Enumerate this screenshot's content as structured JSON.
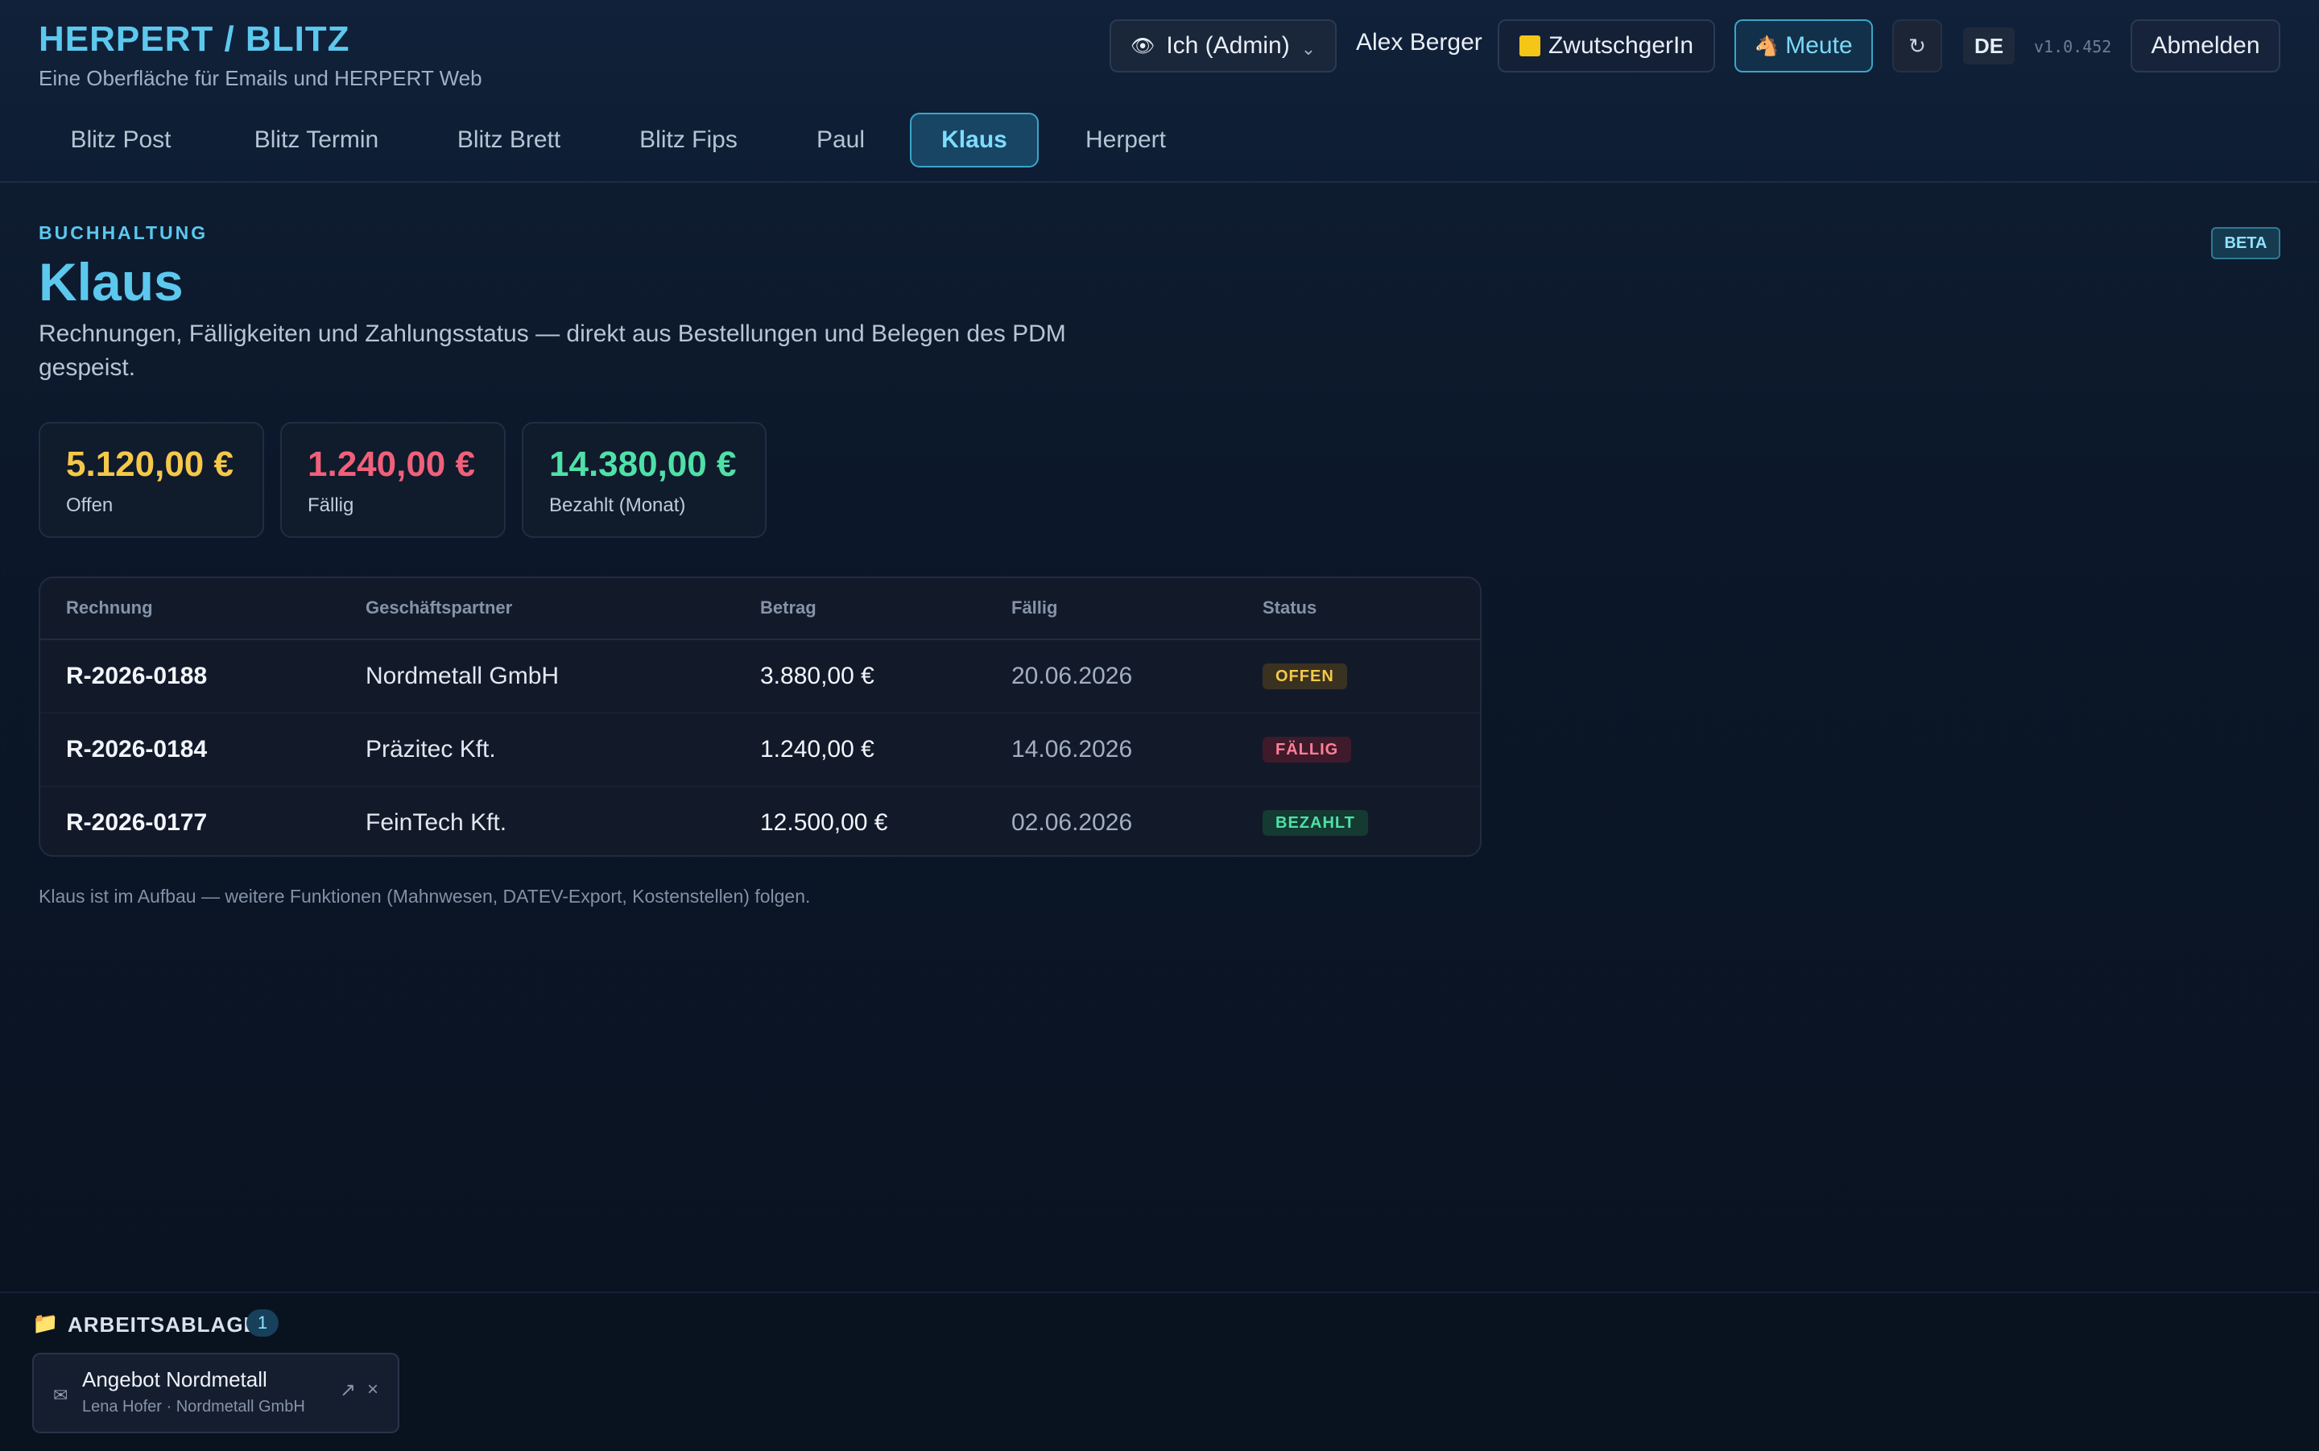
{
  "header": {
    "title": "HERPERT / BLITZ",
    "subtitle": "Eine Oberfläche für Emails und HERPERT Web",
    "role_selector": {
      "icon": "eye-icon",
      "label": "Ich (Admin)",
      "chevron": "⌄"
    },
    "user_name": "Alex Berger",
    "zwb_button": {
      "icon": "yellow-square-icon",
      "label": "ZwutschgerIn"
    },
    "meute_button": {
      "icon": "horse-head-icon",
      "label": "Meute",
      "glyph": "🐴"
    },
    "refresh_glyph": "↻",
    "language": "DE",
    "version": "v1.0.452",
    "logout_label": "Abmelden"
  },
  "tabs": [
    {
      "label": "Blitz Post",
      "active": false
    },
    {
      "label": "Blitz Termin",
      "active": false
    },
    {
      "label": "Blitz Brett",
      "active": false
    },
    {
      "label": "Blitz Fips",
      "active": false
    },
    {
      "label": "Paul",
      "active": false
    },
    {
      "label": "Klaus",
      "active": true
    },
    {
      "label": "Herpert",
      "active": false
    }
  ],
  "main": {
    "section_label": "BUCHHALTUNG",
    "title": "Klaus",
    "description": "Rechnungen, Fälligkeiten und Zahlungsstatus — direkt aus Bestellungen und Belegen des PDM gespeist.",
    "badge": "BETA",
    "stats": [
      {
        "value": "5.120,00 €",
        "label": "Offen",
        "color": "#f5c84a"
      },
      {
        "value": "1.240,00 €",
        "label": "Fällig",
        "color": "#f0607a"
      },
      {
        "value": "14.380,00 €",
        "label": "Bezahlt (Monat)",
        "color": "#4fe0a8"
      }
    ],
    "table": {
      "columns": [
        "Rechnung",
        "Geschäftspartner",
        "Betrag",
        "Fällig",
        "Status"
      ],
      "rows": [
        {
          "invoice": "R-2026-0188",
          "partner": "Nordmetall GmbH",
          "amount": "3.880,00 €",
          "due": "20.06.2026",
          "status": "OFFEN",
          "status_fg": "#f5c84a",
          "status_bg": "#3a3220"
        },
        {
          "invoice": "R-2026-0184",
          "partner": "Präzitec Kft.",
          "amount": "1.240,00 €",
          "due": "14.06.2026",
          "status": "FÄLLIG",
          "status_fg": "#ff7f9a",
          "status_bg": "#3f1a2a"
        },
        {
          "invoice": "R-2026-0177",
          "partner": "FeinTech Kft.",
          "amount": "12.500,00 €",
          "due": "02.06.2026",
          "status": "BEZAHLT",
          "status_fg": "#4fe0a8",
          "status_bg": "#143a32"
        }
      ]
    },
    "footnote": "Klaus ist im Aufbau — weitere Funktionen (Mahnwesen, DATEV-Export, Kostenstellen) folgen."
  },
  "tray": {
    "icon": "folder-icon",
    "title": "ARBEITSABLAGE",
    "count": "1",
    "items": [
      {
        "icon": "mail-icon",
        "title": "Angebot Nordmetall",
        "subtitle": "Lena Hofer · Nordmetall GmbH",
        "open_glyph": "↗",
        "close_glyph": "×"
      }
    ]
  }
}
